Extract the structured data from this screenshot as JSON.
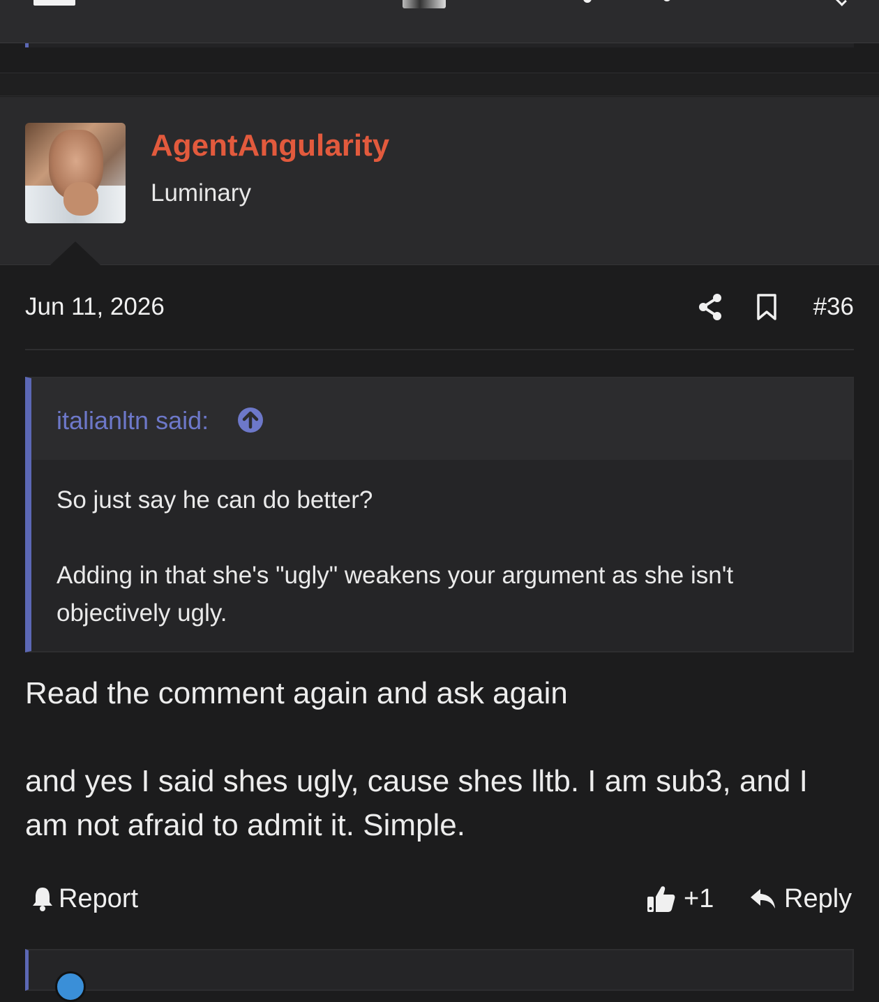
{
  "post": {
    "author": "AgentAngularity",
    "author_title": "Luminary",
    "date": "Jun 11, 2026",
    "number": "#36",
    "quote": {
      "author_label": "italianltn said:",
      "lines": [
        "So just say he can do better?",
        "Adding in that she's \"ugly\" weakens your argument as she isn't",
        "objectively ugly."
      ]
    },
    "body_lines": [
      "Read the comment again and ask again",
      "and yes I said shes ugly, cause shes lltb. I am sub3, and I",
      "am not afraid to admit it. Simple."
    ],
    "actions": {
      "report": "Report",
      "like_count": "+1",
      "reply": "Reply"
    }
  },
  "icons": {
    "share": "share-icon",
    "bookmark": "bookmark-icon",
    "quote_jump": "arrow-up-circle-icon",
    "report": "bell-icon",
    "like": "thumbs-up-icon",
    "reply": "reply-arrow-icon"
  },
  "colors": {
    "accent": "#5c68b5",
    "username": "#e25a3d",
    "quote_author": "#6d78c9",
    "background": "#1c1c1d"
  }
}
